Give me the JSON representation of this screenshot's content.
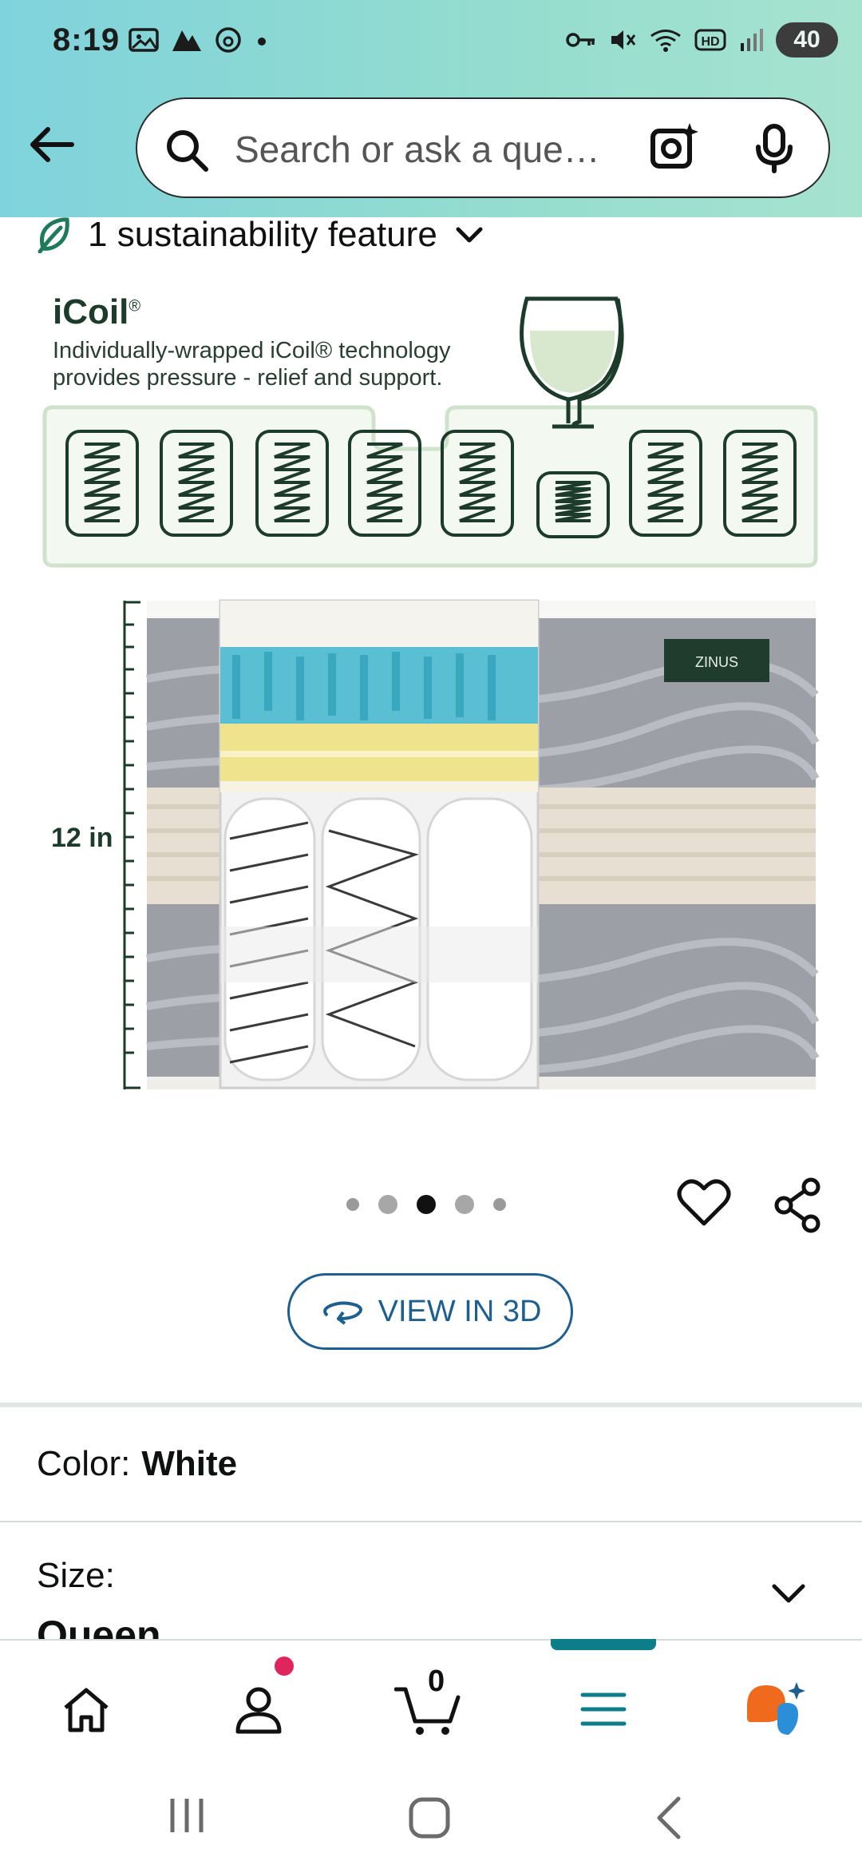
{
  "status_bar": {
    "time": "8:19",
    "battery": "40",
    "icons_left": [
      "gallery-icon",
      "maps-icon",
      "threads-icon",
      "dot-icon"
    ],
    "icons_right": [
      "vpn-key-icon",
      "mute-icon",
      "wifi-icon",
      "hd-icon",
      "signal-icon"
    ]
  },
  "search": {
    "placeholder": "Search or ask a que…"
  },
  "sustainability": {
    "label": "1 sustainability feature"
  },
  "product_image": {
    "title": "iCoil",
    "title_mark": "®",
    "description": "Individually-wrapped  iCoil® technology provides pressure - relief and support.",
    "height_label": "12 in",
    "brand_tag": "ZINUS"
  },
  "carousel": {
    "count": 5,
    "active_index": 2
  },
  "view3d": {
    "label": "VIEW IN 3D"
  },
  "variations": {
    "color_label": "Color:",
    "color_value": "White",
    "size_label": "Size:",
    "size_value": "Queen"
  },
  "bottom_nav": {
    "cart_count": "0",
    "items": [
      "home",
      "account",
      "cart",
      "menu",
      "rufus"
    ],
    "active": "menu"
  },
  "colors": {
    "accent_teal": "#0d7d8a",
    "link_blue": "#1f5f8f",
    "leaf_green": "#1d3b2a"
  }
}
